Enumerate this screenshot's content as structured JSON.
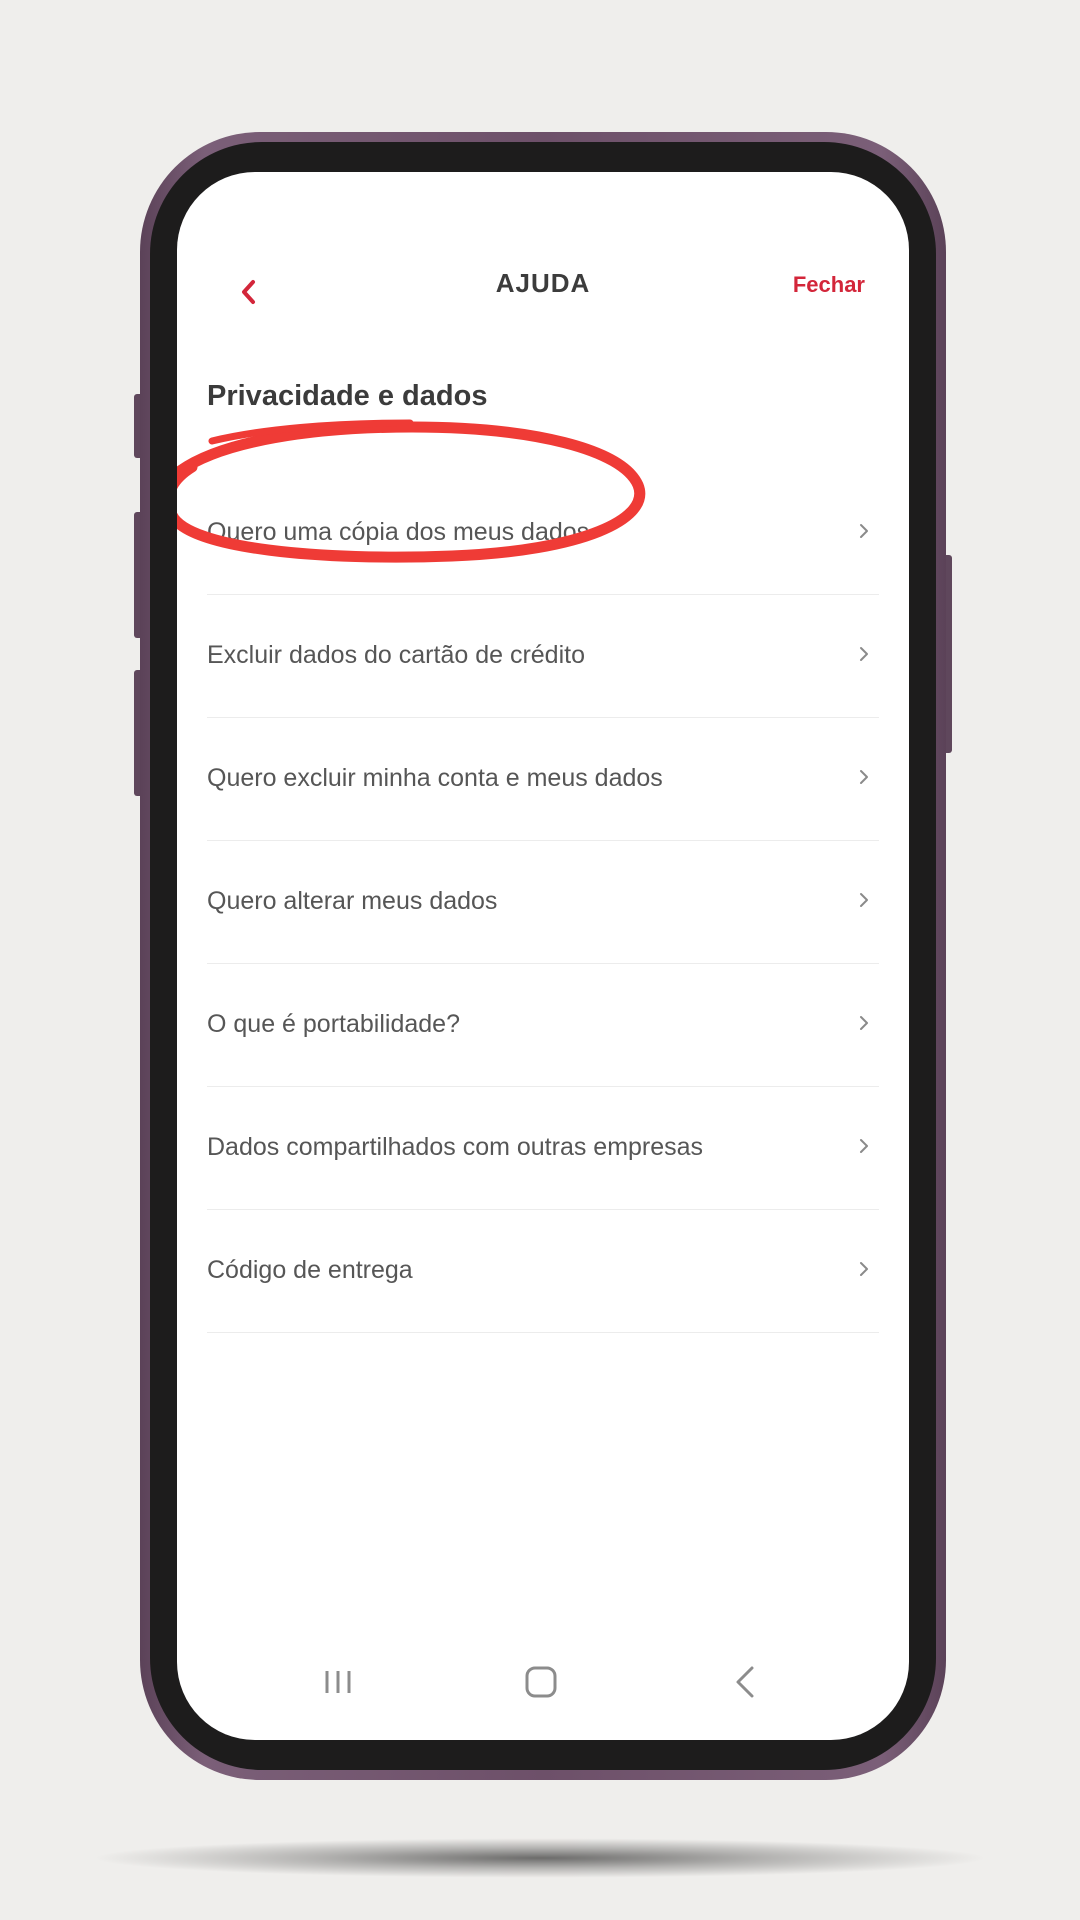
{
  "header": {
    "title": "AJUDA",
    "close_label": "Fechar",
    "back_icon": "chevron-left-icon"
  },
  "section": {
    "title": "Privacidade e dados"
  },
  "items": [
    {
      "label": "Quero uma cópia dos meus dados",
      "highlighted": true
    },
    {
      "label": "Excluir dados do cartão de crédito"
    },
    {
      "label": "Quero excluir minha conta e meus dados"
    },
    {
      "label": "Quero alterar meus dados"
    },
    {
      "label": "O que é portabilidade?"
    },
    {
      "label": "Dados compartilhados com outras empresas"
    },
    {
      "label": "Código de entrega"
    }
  ],
  "navbar": {
    "recents_icon": "recents-icon",
    "home_icon": "home-icon",
    "back_icon": "back-icon"
  },
  "colors": {
    "accent": "#d3263a",
    "annotation": "#ef3b36",
    "phone_frame": "#6d5069",
    "background": "#efeeec"
  }
}
